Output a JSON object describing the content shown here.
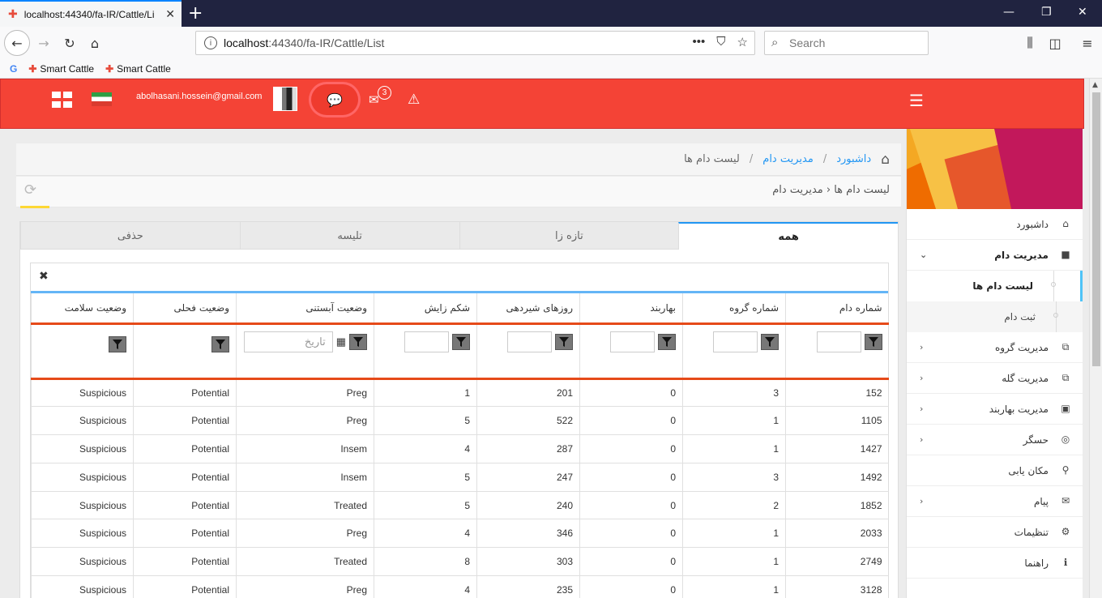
{
  "browser": {
    "tab_title": "localhost:44340/fa-IR/Cattle/Li",
    "url_host": "localhost",
    "url_path": ":44340/fa-IR/Cattle/List",
    "search_placeholder": "Search",
    "bookmarks": [
      "Smart Cattle",
      "Smart Cattle"
    ]
  },
  "header": {
    "email": "abolhasani.hossein@gmail.com",
    "mail_count": "3"
  },
  "breadcrumb": {
    "home": "داشبورد",
    "section": "مدیریت دام",
    "current": "لیست دام ها",
    "sep": "/"
  },
  "page": {
    "title": "لیست دام ها ‹ مدیریت دام"
  },
  "tabs": [
    "همه",
    "تازه زا",
    "تلیسه",
    "حذفی"
  ],
  "sidebar": {
    "items": [
      {
        "label": "داشبورد",
        "icon": "home-icon",
        "glyph": "⌂"
      },
      {
        "label": "مدیریت دام",
        "icon": "square-icon",
        "glyph": "■"
      },
      {
        "label": "مدیریت گروه",
        "icon": "sitemap-icon",
        "glyph": "⧉"
      },
      {
        "label": "مدیریت گله",
        "icon": "sitemap-icon",
        "glyph": "⧉"
      },
      {
        "label": "مدیریت بهاربند",
        "icon": "barn-icon",
        "glyph": "▣"
      },
      {
        "label": "حسگر",
        "icon": "sensor-icon",
        "glyph": "◎"
      },
      {
        "label": "مکان یابی",
        "icon": "map-marker-icon",
        "glyph": "⚲"
      },
      {
        "label": "پیام",
        "icon": "envelope-icon",
        "glyph": "✉"
      },
      {
        "label": "تنظیمات",
        "icon": "gear-icon",
        "glyph": "⚙"
      },
      {
        "label": "راهنما",
        "icon": "info-icon",
        "glyph": "ℹ"
      }
    ],
    "sub_items": [
      "لیست دام ها",
      "ثبت دام"
    ]
  },
  "table": {
    "columns": [
      "شماره دام",
      "شماره گروه",
      "بهاربند",
      "روزهای شیردهی",
      "شکم زایش",
      "وضعیت آبستنی",
      "وضعیت فحلی",
      "وضعیت سلامت"
    ],
    "date_placeholder": "تاریخ",
    "rows": [
      [
        "152",
        "3",
        "0",
        "201",
        "1",
        "Preg",
        "Potential",
        "Suspicious"
      ],
      [
        "1105",
        "1",
        "0",
        "522",
        "5",
        "Preg",
        "Potential",
        "Suspicious"
      ],
      [
        "1427",
        "1",
        "0",
        "287",
        "4",
        "Insem",
        "Potential",
        "Suspicious"
      ],
      [
        "1492",
        "3",
        "0",
        "247",
        "5",
        "Insem",
        "Potential",
        "Suspicious"
      ],
      [
        "1852",
        "2",
        "0",
        "240",
        "5",
        "Treated",
        "Potential",
        "Suspicious"
      ],
      [
        "2033",
        "1",
        "0",
        "346",
        "4",
        "Preg",
        "Potential",
        "Suspicious"
      ],
      [
        "2749",
        "1",
        "0",
        "303",
        "8",
        "Treated",
        "Potential",
        "Suspicious"
      ],
      [
        "3128",
        "1",
        "0",
        "235",
        "4",
        "Preg",
        "Potential",
        "Suspicious"
      ]
    ]
  }
}
